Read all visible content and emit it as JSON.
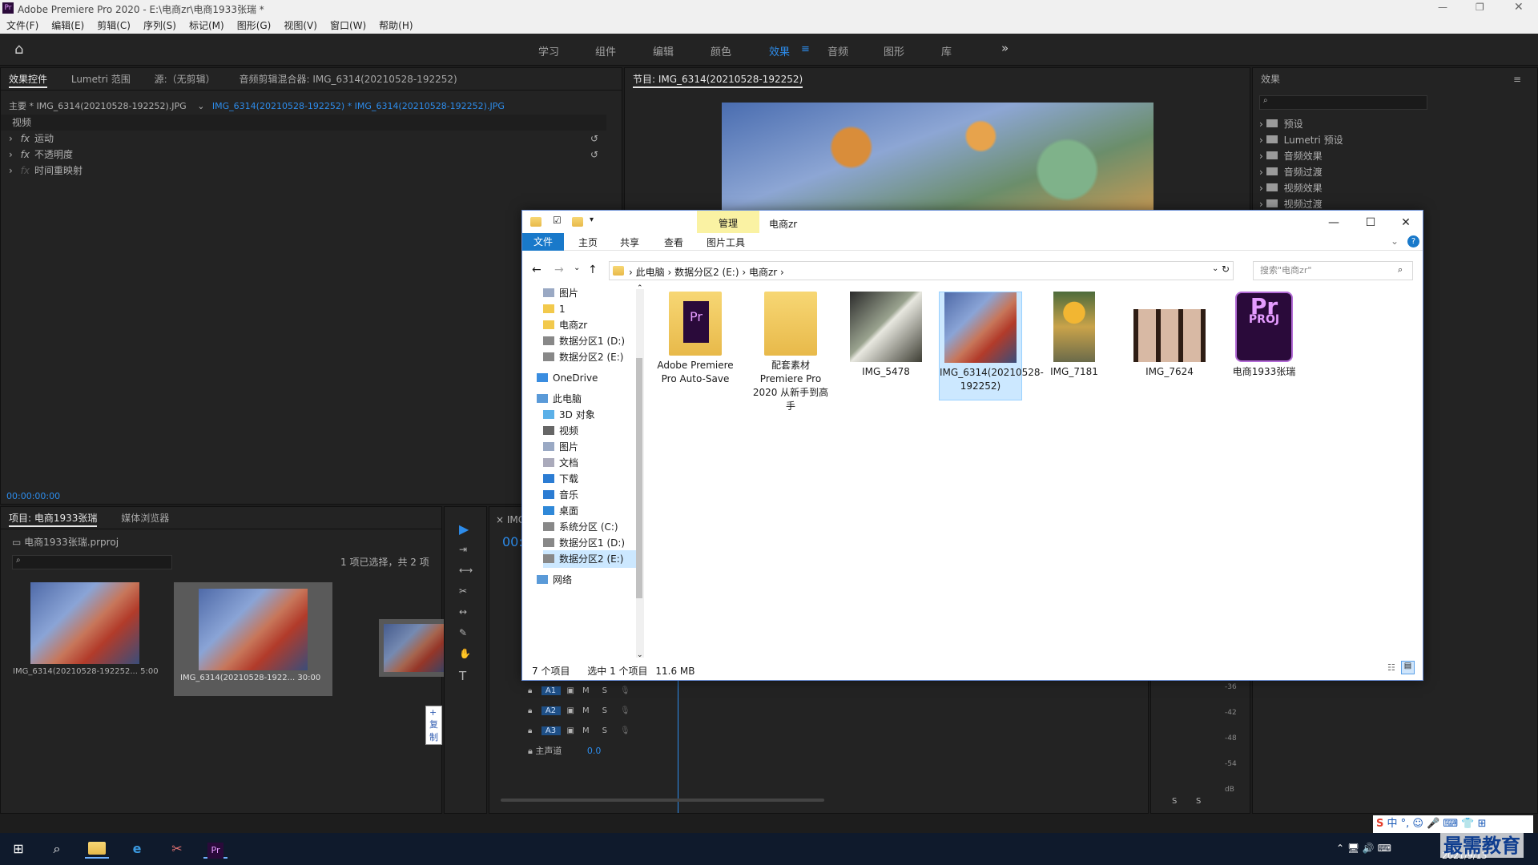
{
  "app": {
    "title": "Adobe Premiere Pro 2020 - E:\\电商zr\\电商1933张瑞 *",
    "menu": [
      "文件(F)",
      "编辑(E)",
      "剪辑(C)",
      "序列(S)",
      "标记(M)",
      "图形(G)",
      "视图(V)",
      "窗口(W)",
      "帮助(H)"
    ],
    "workspaces": [
      "学习",
      "组件",
      "编辑",
      "颜色",
      "效果",
      "音频",
      "图形",
      "库"
    ],
    "active_workspace": "效果",
    "overflow": "»"
  },
  "effect_controls": {
    "tabs": [
      "效果控件",
      "Lumetri 范围",
      "源:（无剪辑）",
      "音频剪辑混合器: IMG_6314(20210528-192252)"
    ],
    "master": "主要 * IMG_6314(20210528-192252).JPG",
    "clip": "IMG_6314(20210528-192252) * IMG_6314(20210528-192252).JPG",
    "section": "视频",
    "rows": [
      "运动",
      "不透明度",
      "时间重映射"
    ],
    "fx": "fx",
    "timecode": "00:00:00:00"
  },
  "program": {
    "title": "节目: IMG_6314(20210528-192252)"
  },
  "effects": {
    "title": "效果",
    "items": [
      "预设",
      "Lumetri 预设",
      "音频效果",
      "音频过渡",
      "视频效果",
      "视频过渡"
    ]
  },
  "project": {
    "tabs": [
      "项目: 电商1933张瑞",
      "媒体浏览器"
    ],
    "file": "电商1933张瑞.prproj",
    "selection": "1 项已选择，共 2 项",
    "clips": [
      {
        "name": "IMG_6314(20210528-192252...",
        "dur": "5:00"
      },
      {
        "name": "IMG_6314(20210528-1922...",
        "dur": "30:00"
      }
    ],
    "copy_label": "+ 复制"
  },
  "timeline": {
    "tab": "IMG",
    "timecode": "00:",
    "tracks": [
      "A1",
      "A2",
      "A3"
    ],
    "master": "主声道",
    "master_val": "0.0",
    "m": "M",
    "s": "S"
  },
  "meter": {
    "labels": [
      "-36",
      "-42",
      "-48",
      "-54",
      "dB"
    ],
    "s": "S"
  },
  "explorer": {
    "title": "电商zr",
    "manage": "管理",
    "ribbon": [
      "文件",
      "主页",
      "共享",
      "查看"
    ],
    "picture_tools": "图片工具",
    "breadcrumb": [
      "此电脑",
      "数据分区2 (E:)",
      "电商zr"
    ],
    "search_placeholder": "搜索\"电商zr\"",
    "nav": [
      "图片",
      "1",
      "电商zr",
      "数据分区1 (D:)",
      "数据分区2 (E:)",
      "OneDrive",
      "此电脑",
      "3D 对象",
      "视频",
      "图片",
      "文档",
      "下载",
      "音乐",
      "桌面",
      "系统分区 (C:)",
      "数据分区1 (D:)",
      "数据分区2 (E:)",
      "网络"
    ],
    "items": [
      {
        "name": "Adobe Premiere Pro Auto-Save",
        "type": "prfolder"
      },
      {
        "name": "配套素材 Premiere Pro 2020 从新手到高手",
        "type": "folder"
      },
      {
        "name": "IMG_5478",
        "type": "photo1"
      },
      {
        "name": "IMG_6314(20210528-192252)",
        "type": "photo2"
      },
      {
        "name": "IMG_7181",
        "type": "photo3"
      },
      {
        "name": "IMG_7624",
        "type": "photo4"
      },
      {
        "name": "电商1933张瑞",
        "type": "proj"
      }
    ],
    "status": {
      "count": "7 个项目",
      "selected": "选中 1 个项目",
      "size": "11.6 MB"
    },
    "pr_text": "Pr",
    "proj_text": "PROJ"
  },
  "taskbar": {
    "date": "2021/9/13",
    "ime": "中",
    "brand": "最需教育"
  },
  "colors": {
    "accent": "#2d8ceb",
    "pr": "#2a0a3a",
    "pr_text": "#e59cff",
    "explorer_accent": "#1979ca"
  }
}
